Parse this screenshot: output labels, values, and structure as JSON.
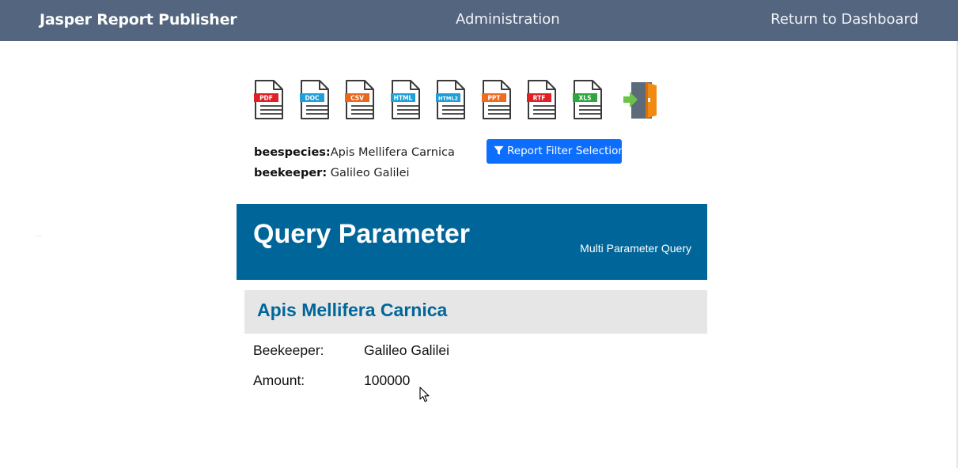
{
  "nav": {
    "brand": "Jasper Report Publisher",
    "admin": "Administration",
    "dashboard": "Return to Dashboard"
  },
  "exports": [
    {
      "label": "PDF",
      "color": "#e01f26",
      "icon": "pdf-file-icon"
    },
    {
      "label": "DOC",
      "color": "#1e9fd8",
      "icon": "doc-file-icon"
    },
    {
      "label": "CSV",
      "color": "#e8691c",
      "icon": "csv-file-icon"
    },
    {
      "label": "HTML",
      "color": "#1e9fd8",
      "icon": "html-file-icon"
    },
    {
      "label": "HTML2",
      "color": "#1e9fd8",
      "icon": "html2-file-icon"
    },
    {
      "label": "PPT",
      "color": "#ee6b1f",
      "icon": "ppt-file-icon"
    },
    {
      "label": "RTF",
      "color": "#e01f26",
      "icon": "rtf-file-icon"
    },
    {
      "label": "XLS",
      "color": "#2ea640",
      "icon": "xls-file-icon"
    }
  ],
  "exit_icon": "exit-door-icon",
  "params": {
    "beespecies_label": "beespecies:",
    "beespecies_value": "Apis Mellifera Carnica",
    "beekeeper_label": "beekeeper:",
    "beekeeper_value": "Galileo Galilei"
  },
  "filter_button": {
    "label": "Report Filter Selection",
    "icon": "filter-icon",
    "color": "#0d6efd"
  },
  "report": {
    "title": "Query Parameter",
    "subtitle": "Multi Parameter Query",
    "header_color": "#006699",
    "group_title": "Apis Mellifera Carnica",
    "rows": [
      {
        "label": "Beekeeper:",
        "value": "Galileo Galilei"
      },
      {
        "label": "Amount:",
        "value": "100000"
      }
    ]
  }
}
